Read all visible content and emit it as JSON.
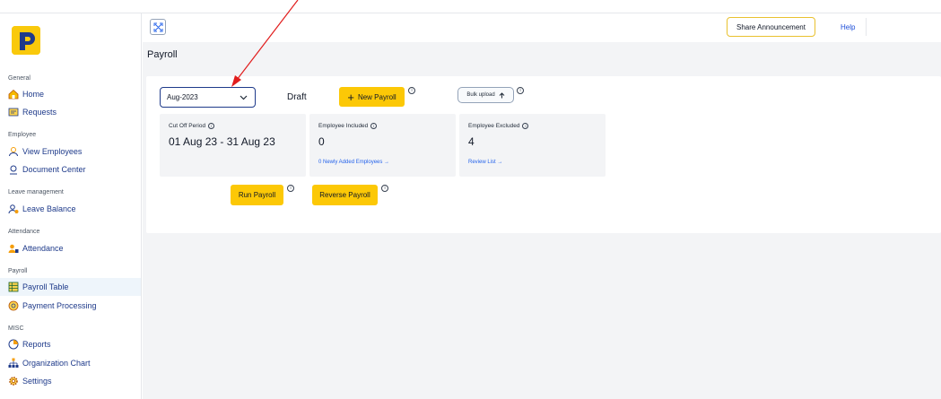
{
  "brand": {
    "logo_letter_icon": "p-logo",
    "accent": "#fcc806"
  },
  "sidebar": {
    "sections": [
      {
        "label": "General",
        "items": [
          {
            "label": "Home",
            "icon": "home-icon"
          },
          {
            "label": "Requests",
            "icon": "requests-icon"
          }
        ]
      },
      {
        "label": "Employee",
        "items": [
          {
            "label": "View Employees",
            "icon": "users-icon"
          },
          {
            "label": "Document Center",
            "icon": "document-icon"
          }
        ]
      },
      {
        "label": "Leave management",
        "items": [
          {
            "label": "Leave Balance",
            "icon": "leave-icon"
          }
        ]
      },
      {
        "label": "Attendance",
        "items": [
          {
            "label": "Attendance",
            "icon": "attendance-icon"
          }
        ]
      },
      {
        "label": "Payroll",
        "items": [
          {
            "label": "Payroll Table",
            "icon": "table-icon",
            "active": true
          },
          {
            "label": "Payment Processing",
            "icon": "payment-icon"
          }
        ]
      },
      {
        "label": "MISC",
        "items": [
          {
            "label": "Reports",
            "icon": "reports-icon"
          },
          {
            "label": "Organization Chart",
            "icon": "org-chart-icon"
          },
          {
            "label": "Settings",
            "icon": "gear-icon"
          }
        ]
      }
    ]
  },
  "topbar": {
    "expand_icon": "expand-icon",
    "share_label": "Share Announcement",
    "help_label": "Help"
  },
  "main": {
    "title": "Payroll",
    "month_selected": "Aug-2023",
    "status": "Draft",
    "new_payroll_label": "New Payroll",
    "bulk_upload_label": "Bulk upload",
    "cards": [
      {
        "label": "Cut Off Period",
        "value": "01 Aug 23 - 31 Aug 23",
        "link": ""
      },
      {
        "label": "Employee Included",
        "value": "0",
        "link": "0 Newly Added Employees →"
      },
      {
        "label": "Employee Excluded",
        "value": "4",
        "link": "Review List →"
      }
    ],
    "run_payroll_label": "Run Payroll",
    "reverse_payroll_label": "Reverse Payroll",
    "info_glyph": "i"
  },
  "colors": {
    "link": "#2563eb",
    "nav_text": "#1e3a8a",
    "annotation_arrow": "#e11d1d"
  }
}
